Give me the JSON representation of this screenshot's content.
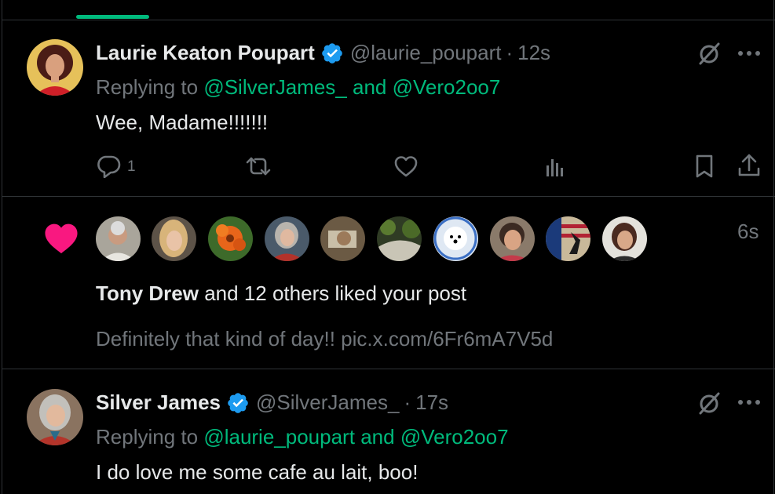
{
  "posts": [
    {
      "name": "Laurie Keaton Poupart",
      "handle": "@laurie_poupart",
      "sep": "·",
      "time": "12s",
      "replying_prefix": "Replying to",
      "replying_to_1": "@SilverJames_",
      "replying_and": "and",
      "replying_to_2": "@Vero2oo7",
      "text": "Wee, Madame!!!!!!!",
      "reply_count": "1"
    },
    {
      "name": "Silver James",
      "handle": "@SilverJames_",
      "sep": "·",
      "time": "17s",
      "replying_prefix": "Replying to",
      "replying_to_1": "@laurie_poupart",
      "replying_and": "and",
      "replying_to_2": "@Vero2oo7",
      "text": "I do love me some cafe au lait, boo!"
    }
  ],
  "notification": {
    "time": "6s",
    "liker": "Tony Drew",
    "message": "and 12 others liked your post",
    "quoted_text": "Definitely that kind of day!! pic.x.com/6Fr6mA7V5d",
    "avatar_count": 10
  },
  "colors": {
    "accent": "#00ba7c",
    "verified": "#1d9bf0",
    "like": "#f91880",
    "muted": "#71767b",
    "text": "#e7e9ea",
    "border": "#2f3336"
  },
  "icons": [
    "reply-icon",
    "retweet-icon",
    "like-icon",
    "views-icon",
    "bookmark-icon",
    "share-icon",
    "grok-icon",
    "more-icon",
    "verified-icon",
    "heart-icon"
  ]
}
